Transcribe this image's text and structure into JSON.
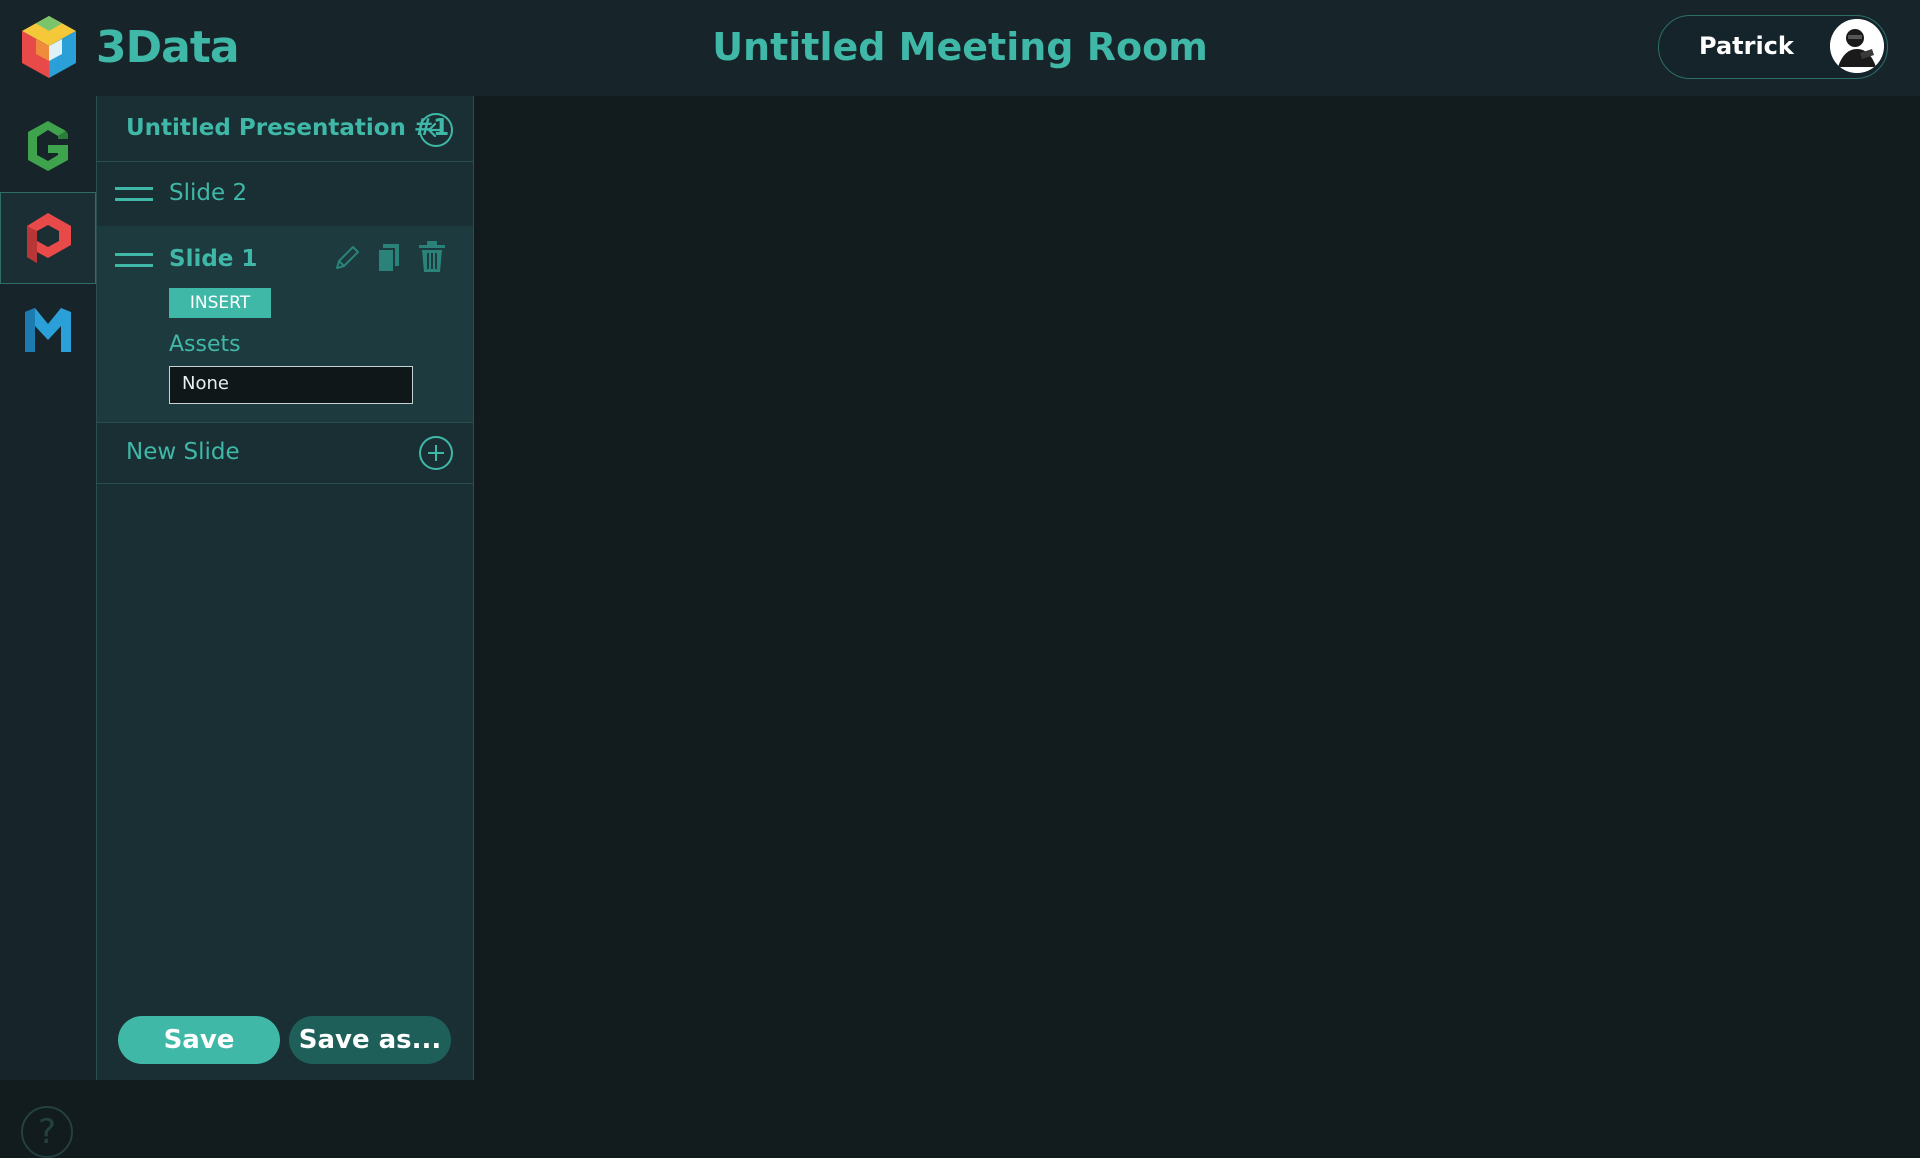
{
  "header": {
    "brand": "3Data",
    "room_title": "Untitled Meeting Room",
    "user_name": "Patrick"
  },
  "rail": {
    "items": [
      {
        "name": "G",
        "color": "#3fa34d"
      },
      {
        "name": "P",
        "color": "#e84a4a",
        "active": true
      },
      {
        "name": "M",
        "color": "#2b9fd8"
      }
    ],
    "help_glyph": "?"
  },
  "panel": {
    "title": "Untitled Presentation #1",
    "slides": [
      {
        "label": "Slide 2",
        "selected": false
      },
      {
        "label": "Slide 1",
        "selected": true
      }
    ],
    "insert_label": "INSERT",
    "assets_label": "Assets",
    "assets_value": "None",
    "new_slide_label": "New Slide",
    "save_label": "Save",
    "save_as_label": "Save as..."
  },
  "colors": {
    "accent": "#3fb8a8",
    "background": "#121b1d",
    "panel": "#1a2f34"
  }
}
